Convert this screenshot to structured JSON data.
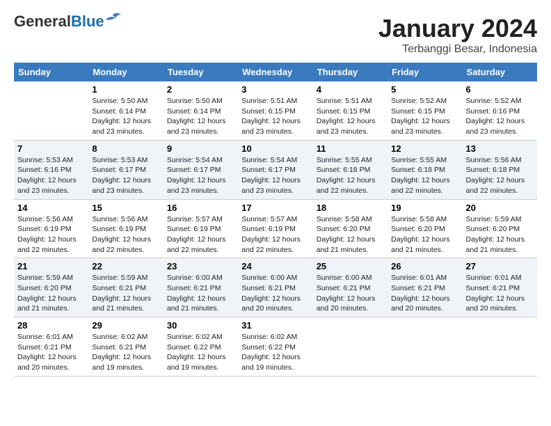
{
  "header": {
    "logo_general": "General",
    "logo_blue": "Blue",
    "month_title": "January 2024",
    "location": "Terbanggi Besar, Indonesia"
  },
  "weekdays": [
    "Sunday",
    "Monday",
    "Tuesday",
    "Wednesday",
    "Thursday",
    "Friday",
    "Saturday"
  ],
  "weeks": [
    [
      {
        "day": "",
        "info": ""
      },
      {
        "day": "1",
        "info": "Sunrise: 5:50 AM\nSunset: 6:14 PM\nDaylight: 12 hours\nand 23 minutes."
      },
      {
        "day": "2",
        "info": "Sunrise: 5:50 AM\nSunset: 6:14 PM\nDaylight: 12 hours\nand 23 minutes."
      },
      {
        "day": "3",
        "info": "Sunrise: 5:51 AM\nSunset: 6:15 PM\nDaylight: 12 hours\nand 23 minutes."
      },
      {
        "day": "4",
        "info": "Sunrise: 5:51 AM\nSunset: 6:15 PM\nDaylight: 12 hours\nand 23 minutes."
      },
      {
        "day": "5",
        "info": "Sunrise: 5:52 AM\nSunset: 6:15 PM\nDaylight: 12 hours\nand 23 minutes."
      },
      {
        "day": "6",
        "info": "Sunrise: 5:52 AM\nSunset: 6:16 PM\nDaylight: 12 hours\nand 23 minutes."
      }
    ],
    [
      {
        "day": "7",
        "info": "Sunrise: 5:53 AM\nSunset: 6:16 PM\nDaylight: 12 hours\nand 23 minutes."
      },
      {
        "day": "8",
        "info": "Sunrise: 5:53 AM\nSunset: 6:17 PM\nDaylight: 12 hours\nand 23 minutes."
      },
      {
        "day": "9",
        "info": "Sunrise: 5:54 AM\nSunset: 6:17 PM\nDaylight: 12 hours\nand 23 minutes."
      },
      {
        "day": "10",
        "info": "Sunrise: 5:54 AM\nSunset: 6:17 PM\nDaylight: 12 hours\nand 23 minutes."
      },
      {
        "day": "11",
        "info": "Sunrise: 5:55 AM\nSunset: 6:18 PM\nDaylight: 12 hours\nand 22 minutes."
      },
      {
        "day": "12",
        "info": "Sunrise: 5:55 AM\nSunset: 6:18 PM\nDaylight: 12 hours\nand 22 minutes."
      },
      {
        "day": "13",
        "info": "Sunrise: 5:56 AM\nSunset: 6:18 PM\nDaylight: 12 hours\nand 22 minutes."
      }
    ],
    [
      {
        "day": "14",
        "info": "Sunrise: 5:56 AM\nSunset: 6:19 PM\nDaylight: 12 hours\nand 22 minutes."
      },
      {
        "day": "15",
        "info": "Sunrise: 5:56 AM\nSunset: 6:19 PM\nDaylight: 12 hours\nand 22 minutes."
      },
      {
        "day": "16",
        "info": "Sunrise: 5:57 AM\nSunset: 6:19 PM\nDaylight: 12 hours\nand 22 minutes."
      },
      {
        "day": "17",
        "info": "Sunrise: 5:57 AM\nSunset: 6:19 PM\nDaylight: 12 hours\nand 22 minutes."
      },
      {
        "day": "18",
        "info": "Sunrise: 5:58 AM\nSunset: 6:20 PM\nDaylight: 12 hours\nand 21 minutes."
      },
      {
        "day": "19",
        "info": "Sunrise: 5:58 AM\nSunset: 6:20 PM\nDaylight: 12 hours\nand 21 minutes."
      },
      {
        "day": "20",
        "info": "Sunrise: 5:59 AM\nSunset: 6:20 PM\nDaylight: 12 hours\nand 21 minutes."
      }
    ],
    [
      {
        "day": "21",
        "info": "Sunrise: 5:59 AM\nSunset: 6:20 PM\nDaylight: 12 hours\nand 21 minutes."
      },
      {
        "day": "22",
        "info": "Sunrise: 5:59 AM\nSunset: 6:21 PM\nDaylight: 12 hours\nand 21 minutes."
      },
      {
        "day": "23",
        "info": "Sunrise: 6:00 AM\nSunset: 6:21 PM\nDaylight: 12 hours\nand 21 minutes."
      },
      {
        "day": "24",
        "info": "Sunrise: 6:00 AM\nSunset: 6:21 PM\nDaylight: 12 hours\nand 20 minutes."
      },
      {
        "day": "25",
        "info": "Sunrise: 6:00 AM\nSunset: 6:21 PM\nDaylight: 12 hours\nand 20 minutes."
      },
      {
        "day": "26",
        "info": "Sunrise: 6:01 AM\nSunset: 6:21 PM\nDaylight: 12 hours\nand 20 minutes."
      },
      {
        "day": "27",
        "info": "Sunrise: 6:01 AM\nSunset: 6:21 PM\nDaylight: 12 hours\nand 20 minutes."
      }
    ],
    [
      {
        "day": "28",
        "info": "Sunrise: 6:01 AM\nSunset: 6:21 PM\nDaylight: 12 hours\nand 20 minutes."
      },
      {
        "day": "29",
        "info": "Sunrise: 6:02 AM\nSunset: 6:21 PM\nDaylight: 12 hours\nand 19 minutes."
      },
      {
        "day": "30",
        "info": "Sunrise: 6:02 AM\nSunset: 6:22 PM\nDaylight: 12 hours\nand 19 minutes."
      },
      {
        "day": "31",
        "info": "Sunrise: 6:02 AM\nSunset: 6:22 PM\nDaylight: 12 hours\nand 19 minutes."
      },
      {
        "day": "",
        "info": ""
      },
      {
        "day": "",
        "info": ""
      },
      {
        "day": "",
        "info": ""
      }
    ]
  ]
}
